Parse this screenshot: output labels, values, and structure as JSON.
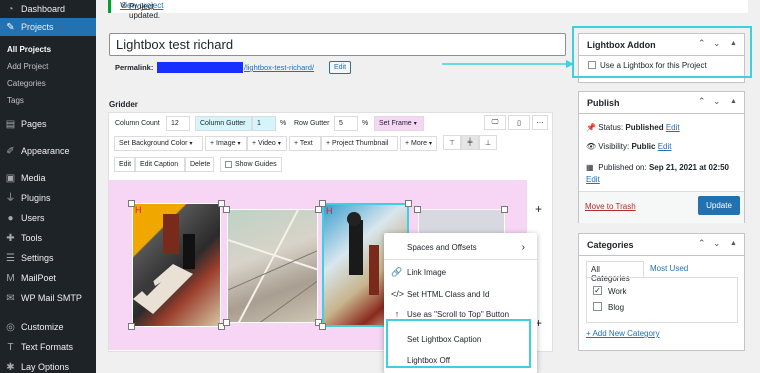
{
  "sidebar": {
    "items": [
      {
        "label": "Dashboard",
        "icon": "gauge-icon"
      },
      {
        "label": "Projects",
        "icon": "pin-icon"
      },
      {
        "label": "Pages",
        "icon": "page-icon"
      },
      {
        "label": "Appearance",
        "icon": "brush-icon"
      },
      {
        "label": "Media",
        "icon": "media-icon"
      },
      {
        "label": "Plugins",
        "icon": "plug-icon"
      },
      {
        "label": "Users",
        "icon": "user-icon"
      },
      {
        "label": "Tools",
        "icon": "wrench-icon"
      },
      {
        "label": "Settings",
        "icon": "sliders-icon"
      },
      {
        "label": "MailPoet",
        "icon": "mailpoet-icon"
      },
      {
        "label": "WP Mail SMTP",
        "icon": "mail-icon"
      },
      {
        "label": "Customize",
        "icon": "customize-icon"
      },
      {
        "label": "Text Formats",
        "icon": "text-icon"
      },
      {
        "label": "Lay Options",
        "icon": "options-icon"
      }
    ],
    "projects_sub": [
      "All Projects",
      "Add Project",
      "Categories",
      "Tags"
    ]
  },
  "notice": {
    "text": "Project updated.",
    "link": "View project"
  },
  "post": {
    "title": "Lightbox test richard",
    "permalink_label": "Permalink:",
    "permalink_slug": "/lightbox-test-richard/",
    "edit_label": "Edit"
  },
  "gridder": {
    "heading": "Gridder",
    "column_count_label": "Column Count",
    "column_count_value": "12",
    "column_gutter_label": "Column Gutter",
    "column_gutter_value": "1",
    "row_gutter_label": "Row Gutter",
    "row_gutter_value": "5",
    "percent": "%",
    "set_frame": "Set Frame",
    "set_bg": "Set Background Color",
    "add_image": "+ Image",
    "add_video": "+ Video",
    "add_text": "+ Text",
    "add_thumb": "+ Project Thumbnail",
    "add_more": "+ More",
    "edit": "Edit",
    "edit_caption": "Edit Caption",
    "delete": "Delete",
    "show_guides": "Show Guides",
    "plus": "+"
  },
  "context_menu": {
    "items": [
      "Spaces and Offsets",
      "Link Image",
      "Set HTML Class and Id",
      "Use as \"Scroll to Top\" Button",
      "Set Lightbox Caption",
      "Lightbox Off"
    ]
  },
  "lightbox_addon": {
    "title": "Lightbox Addon",
    "checkbox_label": "Use a Lightbox for this Project"
  },
  "publish": {
    "title": "Publish",
    "status_label": "Status:",
    "status_value": "Published",
    "visibility_label": "Visibility:",
    "visibility_value": "Public",
    "published_label": "Published on:",
    "published_value": "Sep 21, 2021 at 02:50",
    "edit": "Edit",
    "trash": "Move to Trash",
    "update": "Update"
  },
  "categories": {
    "title": "Categories",
    "tab_all": "All Categories",
    "tab_used": "Most Used",
    "items": [
      {
        "label": "Work",
        "checked": true
      },
      {
        "label": "Blog",
        "checked": false
      }
    ],
    "add_new": "+ Add New Category"
  },
  "colors": {
    "accent": "#2271b1",
    "highlight": "#3ed1dd",
    "canvas": "#f6d5f5",
    "trash": "#b32d2e"
  }
}
